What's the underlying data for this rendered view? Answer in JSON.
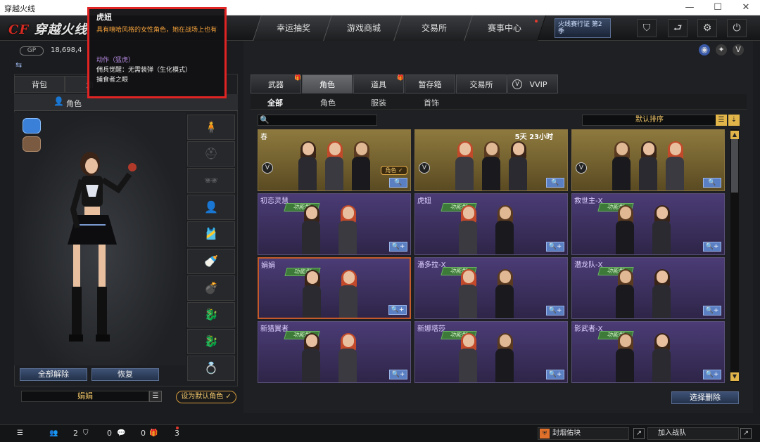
{
  "window": {
    "title": "穿越火线",
    "minimize": "—",
    "maximize": "☐",
    "close": "✕"
  },
  "topbar": {
    "logo_cf": "CF",
    "logo_text": "穿越火线",
    "tabs": [
      {
        "label": "幸运抽奖"
      },
      {
        "label": "游戏商城"
      },
      {
        "label": "交易所"
      },
      {
        "label": "赛事中心"
      }
    ],
    "season_badge": "火线赛行证 第2季",
    "icons": {
      "shield": "⛉",
      "back": "⮐",
      "tools": "⚙",
      "power": "⏻"
    }
  },
  "wallet": {
    "gp_label": "GP",
    "gp_value": "18,698,4"
  },
  "left_tabs": [
    {
      "label": "背包"
    },
    {
      "label": "角"
    }
  ],
  "left_sub": {
    "role_label": "角色"
  },
  "slots_icons": [
    "🧍",
    "⛑",
    "🕶",
    "👤",
    "🎽",
    "🍼",
    "💣",
    "🐉",
    "🐉",
    "💍"
  ],
  "left_buttons": {
    "unequip_all": "全部解除",
    "restore": "恢复"
  },
  "current_character": "娟娟",
  "set_default": "设为默认角色 ✓",
  "tooltip": {
    "title": "虎妞",
    "desc": "具有嘻哈风格的女性角色，她在战场上也有不俗的表现",
    "action": "动作（猛虎）",
    "line1": "佣兵觉醒：无需装弹（生化模式）",
    "line2": "捕食者之眼"
  },
  "right_tabs": [
    {
      "label": "武器",
      "gift": true
    },
    {
      "label": "角色",
      "gift": false
    },
    {
      "label": "道具",
      "gift": true
    },
    {
      "label": "暂存箱",
      "gift": false
    },
    {
      "label": "交易所",
      "gift": false
    },
    {
      "label": "VVIP",
      "gift": false
    }
  ],
  "categories": [
    {
      "label": "全部"
    },
    {
      "label": "角色"
    },
    {
      "label": "服装"
    },
    {
      "label": "首饰"
    }
  ],
  "search": {
    "icon": "🔍",
    "placeholder": ""
  },
  "sort": {
    "label": "默认排序"
  },
  "cards": [
    {
      "name": "春",
      "time": "",
      "type": "",
      "gold": true,
      "role_tag": "角色 ✓",
      "btn": "🔍"
    },
    {
      "name": "",
      "time": "5天 23小时",
      "type": "",
      "gold": true,
      "role_tag": "",
      "btn": "🔍"
    },
    {
      "name": "",
      "time": "",
      "type": "",
      "gold": true,
      "role_tag": "",
      "btn": "🔍"
    },
    {
      "name": "初恋灵慧",
      "time": "",
      "type": "功能型",
      "gold": false,
      "role_tag": "",
      "btn": "🔍+"
    },
    {
      "name": "虎妞",
      "time": "",
      "type": "功能型",
      "gold": false,
      "role_tag": "",
      "btn": "🔍+"
    },
    {
      "name": "救世主-X",
      "time": "",
      "type": "功能型",
      "gold": false,
      "role_tag": "",
      "btn": "🔍+"
    },
    {
      "name": "娟娟",
      "time": "",
      "type": "功能型",
      "gold": false,
      "role_tag": "",
      "btn": "🔍+"
    },
    {
      "name": "潘多拉-X",
      "time": "",
      "type": "功能型",
      "gold": false,
      "role_tag": "",
      "btn": "🔍+"
    },
    {
      "name": "潜龙队-X",
      "time": "",
      "type": "功能型",
      "gold": false,
      "role_tag": "",
      "btn": "🔍+"
    },
    {
      "name": "新猎翼者",
      "time": "",
      "type": "功能型",
      "gold": false,
      "role_tag": "",
      "btn": "🔍+"
    },
    {
      "name": "新娜塔莎",
      "time": "",
      "type": "功能型",
      "gold": false,
      "role_tag": "",
      "btn": "🔍+"
    },
    {
      "name": "影武者-X",
      "time": "",
      "type": "功能型",
      "gold": false,
      "role_tag": "",
      "btn": "🔍+"
    }
  ],
  "clear_button": "选择删除",
  "bottom": {
    "menu": "☰",
    "count1": "2",
    "count2": "0",
    "count3": "0",
    "count4": "3",
    "quit_button": "封烟佑块",
    "join_battle": "加入战队",
    "expand": "↗"
  }
}
